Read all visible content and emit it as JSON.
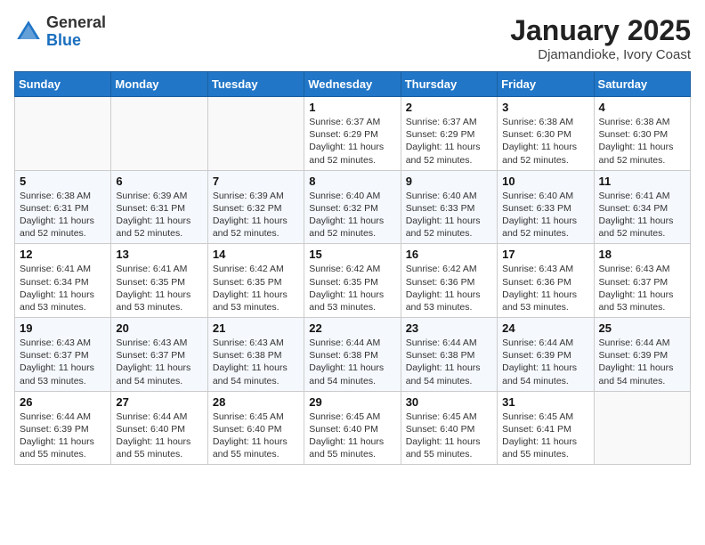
{
  "header": {
    "logo": {
      "general": "General",
      "blue": "Blue"
    },
    "title": "January 2025",
    "location": "Djamandioke, Ivory Coast"
  },
  "calendar": {
    "days_of_week": [
      "Sunday",
      "Monday",
      "Tuesday",
      "Wednesday",
      "Thursday",
      "Friday",
      "Saturday"
    ],
    "weeks": [
      [
        {
          "day": "",
          "info": ""
        },
        {
          "day": "",
          "info": ""
        },
        {
          "day": "",
          "info": ""
        },
        {
          "day": "1",
          "info": "Sunrise: 6:37 AM\nSunset: 6:29 PM\nDaylight: 11 hours\nand 52 minutes."
        },
        {
          "day": "2",
          "info": "Sunrise: 6:37 AM\nSunset: 6:29 PM\nDaylight: 11 hours\nand 52 minutes."
        },
        {
          "day": "3",
          "info": "Sunrise: 6:38 AM\nSunset: 6:30 PM\nDaylight: 11 hours\nand 52 minutes."
        },
        {
          "day": "4",
          "info": "Sunrise: 6:38 AM\nSunset: 6:30 PM\nDaylight: 11 hours\nand 52 minutes."
        }
      ],
      [
        {
          "day": "5",
          "info": "Sunrise: 6:38 AM\nSunset: 6:31 PM\nDaylight: 11 hours\nand 52 minutes."
        },
        {
          "day": "6",
          "info": "Sunrise: 6:39 AM\nSunset: 6:31 PM\nDaylight: 11 hours\nand 52 minutes."
        },
        {
          "day": "7",
          "info": "Sunrise: 6:39 AM\nSunset: 6:32 PM\nDaylight: 11 hours\nand 52 minutes."
        },
        {
          "day": "8",
          "info": "Sunrise: 6:40 AM\nSunset: 6:32 PM\nDaylight: 11 hours\nand 52 minutes."
        },
        {
          "day": "9",
          "info": "Sunrise: 6:40 AM\nSunset: 6:33 PM\nDaylight: 11 hours\nand 52 minutes."
        },
        {
          "day": "10",
          "info": "Sunrise: 6:40 AM\nSunset: 6:33 PM\nDaylight: 11 hours\nand 52 minutes."
        },
        {
          "day": "11",
          "info": "Sunrise: 6:41 AM\nSunset: 6:34 PM\nDaylight: 11 hours\nand 52 minutes."
        }
      ],
      [
        {
          "day": "12",
          "info": "Sunrise: 6:41 AM\nSunset: 6:34 PM\nDaylight: 11 hours\nand 53 minutes."
        },
        {
          "day": "13",
          "info": "Sunrise: 6:41 AM\nSunset: 6:35 PM\nDaylight: 11 hours\nand 53 minutes."
        },
        {
          "day": "14",
          "info": "Sunrise: 6:42 AM\nSunset: 6:35 PM\nDaylight: 11 hours\nand 53 minutes."
        },
        {
          "day": "15",
          "info": "Sunrise: 6:42 AM\nSunset: 6:35 PM\nDaylight: 11 hours\nand 53 minutes."
        },
        {
          "day": "16",
          "info": "Sunrise: 6:42 AM\nSunset: 6:36 PM\nDaylight: 11 hours\nand 53 minutes."
        },
        {
          "day": "17",
          "info": "Sunrise: 6:43 AM\nSunset: 6:36 PM\nDaylight: 11 hours\nand 53 minutes."
        },
        {
          "day": "18",
          "info": "Sunrise: 6:43 AM\nSunset: 6:37 PM\nDaylight: 11 hours\nand 53 minutes."
        }
      ],
      [
        {
          "day": "19",
          "info": "Sunrise: 6:43 AM\nSunset: 6:37 PM\nDaylight: 11 hours\nand 53 minutes."
        },
        {
          "day": "20",
          "info": "Sunrise: 6:43 AM\nSunset: 6:37 PM\nDaylight: 11 hours\nand 54 minutes."
        },
        {
          "day": "21",
          "info": "Sunrise: 6:43 AM\nSunset: 6:38 PM\nDaylight: 11 hours\nand 54 minutes."
        },
        {
          "day": "22",
          "info": "Sunrise: 6:44 AM\nSunset: 6:38 PM\nDaylight: 11 hours\nand 54 minutes."
        },
        {
          "day": "23",
          "info": "Sunrise: 6:44 AM\nSunset: 6:38 PM\nDaylight: 11 hours\nand 54 minutes."
        },
        {
          "day": "24",
          "info": "Sunrise: 6:44 AM\nSunset: 6:39 PM\nDaylight: 11 hours\nand 54 minutes."
        },
        {
          "day": "25",
          "info": "Sunrise: 6:44 AM\nSunset: 6:39 PM\nDaylight: 11 hours\nand 54 minutes."
        }
      ],
      [
        {
          "day": "26",
          "info": "Sunrise: 6:44 AM\nSunset: 6:39 PM\nDaylight: 11 hours\nand 55 minutes."
        },
        {
          "day": "27",
          "info": "Sunrise: 6:44 AM\nSunset: 6:40 PM\nDaylight: 11 hours\nand 55 minutes."
        },
        {
          "day": "28",
          "info": "Sunrise: 6:45 AM\nSunset: 6:40 PM\nDaylight: 11 hours\nand 55 minutes."
        },
        {
          "day": "29",
          "info": "Sunrise: 6:45 AM\nSunset: 6:40 PM\nDaylight: 11 hours\nand 55 minutes."
        },
        {
          "day": "30",
          "info": "Sunrise: 6:45 AM\nSunset: 6:40 PM\nDaylight: 11 hours\nand 55 minutes."
        },
        {
          "day": "31",
          "info": "Sunrise: 6:45 AM\nSunset: 6:41 PM\nDaylight: 11 hours\nand 55 minutes."
        },
        {
          "day": "",
          "info": ""
        }
      ]
    ]
  }
}
